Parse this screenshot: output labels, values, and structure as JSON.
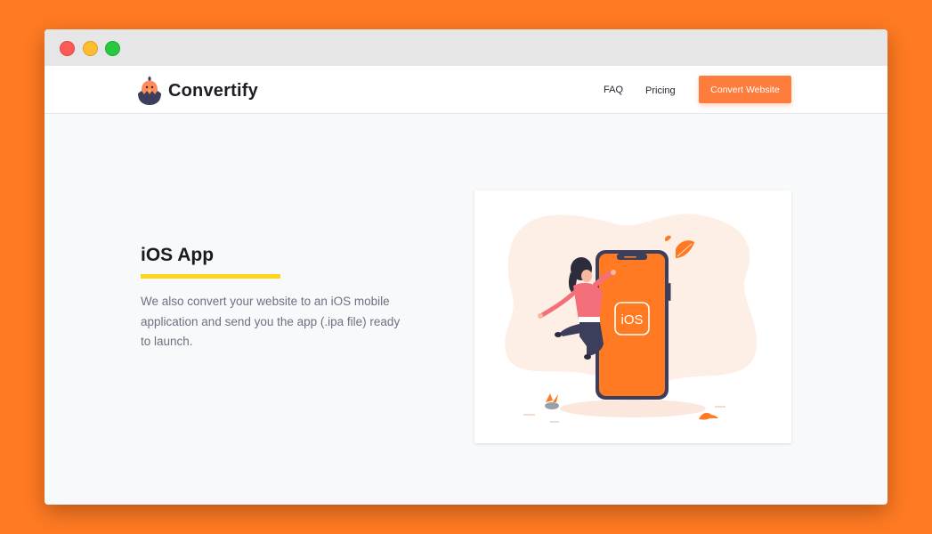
{
  "brand": {
    "name": "Convertify",
    "accent": "#ff7d3c",
    "logo_icon": "chick-in-egg-logo"
  },
  "nav": {
    "links": [
      "FAQ",
      "Pricing"
    ],
    "cta_label": "Convert Website"
  },
  "hero": {
    "heading": "iOS App",
    "underline_color": "#ffd51a",
    "description": "We also convert your website to an iOS mobile application and send you the app (.ipa file) ready to launch.",
    "illustration": {
      "phone_label": "iOS"
    }
  },
  "colors": {
    "background": "#ff7a22",
    "page": "#f8f9fb",
    "phone": "#ff7a22"
  }
}
